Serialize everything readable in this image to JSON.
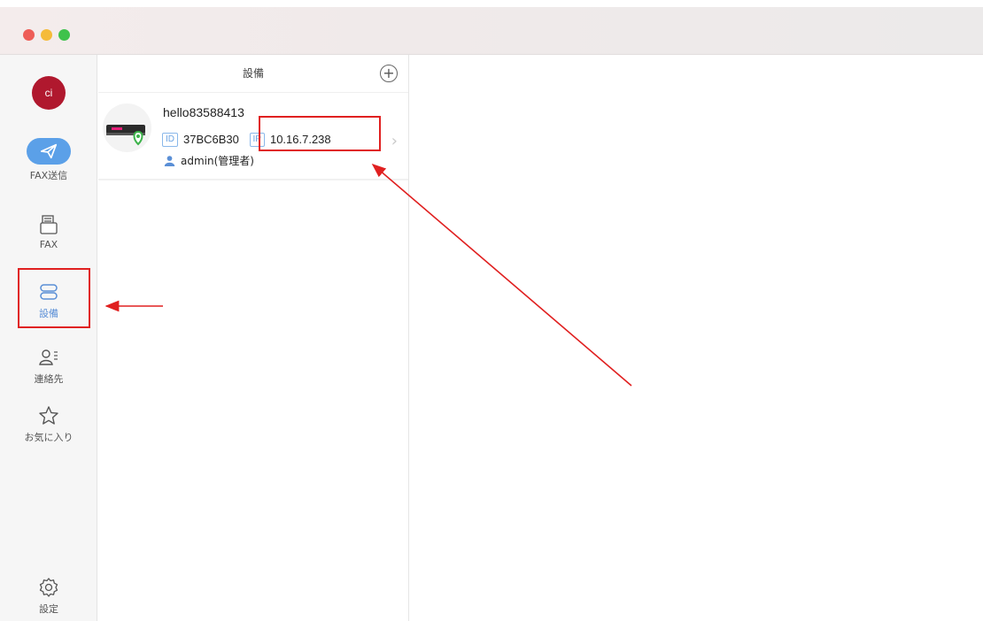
{
  "sidebar": {
    "avatar_text": "ci",
    "items": [
      {
        "label": "FAX送信"
      },
      {
        "label": "FAX"
      },
      {
        "label": "設備"
      },
      {
        "label": "連絡先"
      },
      {
        "label": "お気に入り"
      }
    ],
    "settings_label": "設定"
  },
  "device_panel": {
    "title": "設備",
    "devices": [
      {
        "name": "hello83588413",
        "id_tag": "ID",
        "id_value": "37BC6B30",
        "ip_tag": "IP",
        "ip_value": "10.16.7.238",
        "user": "admin(管理者)"
      }
    ]
  },
  "colors": {
    "accent": "#5ba0e8",
    "avatar": "#b0182e",
    "annotation": "#e02020"
  }
}
